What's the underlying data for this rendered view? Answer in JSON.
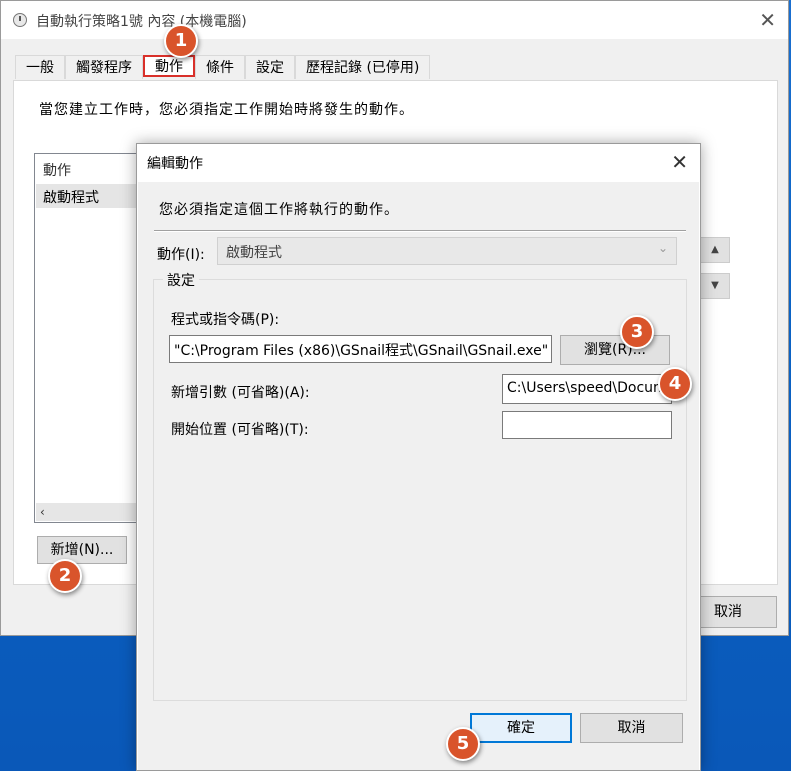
{
  "window": {
    "title": "自動執行策略1號 內容 (本機電腦)",
    "tabs": [
      "一般",
      "觸發程序",
      "動作",
      "條件",
      "設定",
      "歷程記錄 (已停用)"
    ],
    "active_tab": "動作",
    "description": "當您建立工作時，您必須指定工作開始時將發生的動作。",
    "list": {
      "header": "動作",
      "rows": [
        "啟動程式"
      ]
    },
    "new_button": "新增(N)...",
    "cancel_button": "取消"
  },
  "dialog": {
    "title": "編輯動作",
    "description": "您必須指定這個工作將執行的動作。",
    "action_label": "動作(I):",
    "action_value": "啟動程式",
    "settings_legend": "設定",
    "program_label": "程式或指令碼(P):",
    "program_value": "\"C:\\Program Files (x86)\\GSnail程式\\GSnail\\GSnail.exe\"",
    "browse_button": "瀏覽(R)...",
    "args_label": "新增引數 (可省略)(A):",
    "args_value": "C:\\Users\\speed\\Documents",
    "start_label": "開始位置 (可省略)(T):",
    "start_value": "",
    "ok_button": "確定",
    "cancel_button": "取消"
  },
  "markers": [
    "1",
    "2",
    "3",
    "4",
    "5"
  ],
  "colors": {
    "marker": "#d9542b",
    "active_tab_outline": "#d9302a",
    "ok_border": "#0078d7"
  }
}
